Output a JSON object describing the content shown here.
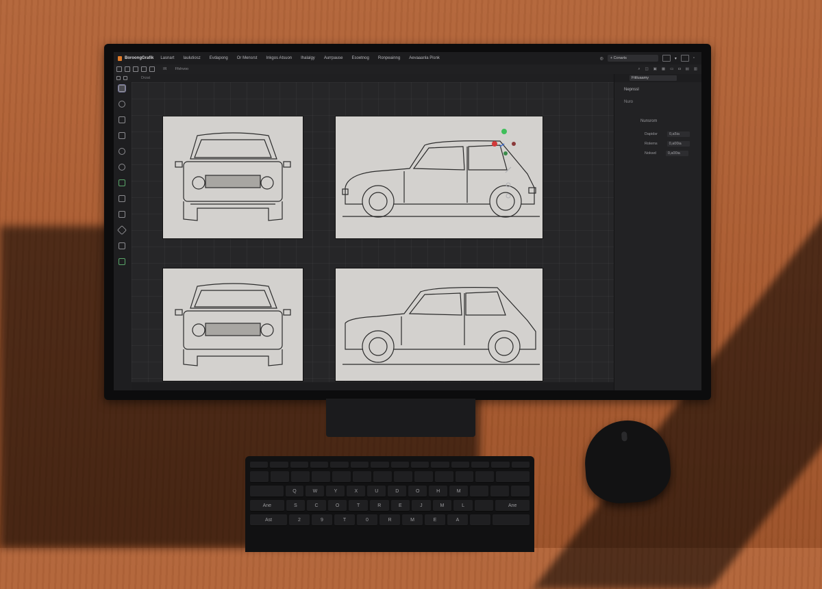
{
  "app": {
    "name": "BoroongGrafik",
    "menus": [
      "Lasnart",
      "Iaulutiosz",
      "Evdapong",
      "Or Mensrst",
      "Inkgos Atsuon",
      "Ihalalgy",
      "Aurrpause",
      "Esoetnog",
      "Ronpeainng",
      "Aevaaanla Pisnk"
    ],
    "search_label": "+ Conarts"
  },
  "toolbar": {
    "label_a": "IR",
    "label_b": "Ffshvoo"
  },
  "subbar": {
    "label": "Drzat"
  },
  "side_panel": {
    "header": "Fitiluaamy",
    "title": "Nepnssl",
    "subtitle": "Nuro",
    "group": "Nunsrom",
    "rows": [
      {
        "label": "Dapidsr",
        "value": "0,a5ia"
      },
      {
        "label": "Rolems",
        "value": "0,a00ia"
      },
      {
        "label": "Nokwd",
        "value": "0,a00ia"
      }
    ]
  },
  "colors": {
    "accent": "#e07b2a",
    "gizmo_green": "#3fbf5a",
    "gizmo_red": "#d23a3a",
    "gizmo_blue": "#3a6ad2"
  },
  "tools": [
    "select-tool-icon",
    "ellipse-tool-icon",
    "frame-tool-icon",
    "layer-tool-icon",
    "add-tool-icon",
    "rotate-tool-icon",
    "bar-tool-icon",
    "text-tool-icon",
    "page-tool-icon",
    "pen-tool-icon",
    "trash-tool-icon",
    "bucket-tool-icon"
  ],
  "keyboard": {
    "row1": [
      "",
      "",
      "",
      "",
      "",
      "",
      "",
      "",
      "",
      "",
      "",
      "",
      "",
      ""
    ],
    "row2": [
      "",
      "",
      "",
      "",
      "",
      "",
      "",
      "",
      "",
      "",
      "",
      "",
      "",
      ""
    ],
    "row3": [
      "",
      "Q",
      "W",
      "Y",
      "X",
      "U",
      "D",
      "O",
      "H",
      "M",
      "",
      "",
      ""
    ],
    "row4": [
      "Ane",
      "S",
      "C",
      "O",
      "T",
      "R",
      "E",
      "J",
      "M",
      "L",
      "",
      "",
      "Ane"
    ],
    "row5": [
      "Ast",
      "2",
      "9",
      "T",
      "0",
      "R",
      "M",
      "E",
      "A",
      "",
      "",
      ""
    ]
  }
}
